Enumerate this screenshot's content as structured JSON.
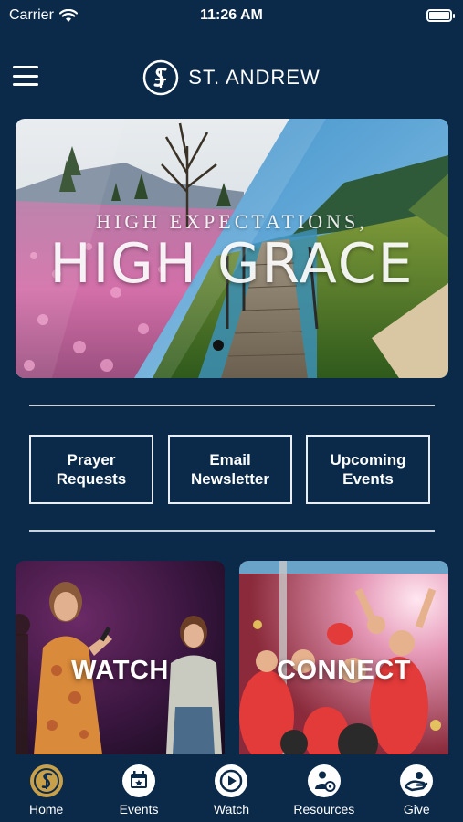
{
  "status": {
    "carrier": "Carrier",
    "time": "11:26 AM"
  },
  "header": {
    "brand_name": "ST. ANDREW"
  },
  "hero": {
    "subtitle": "HIGH EXPECTATIONS,",
    "title": "HIGH GRACE"
  },
  "quick_links": [
    {
      "label": "Prayer\nRequests"
    },
    {
      "label": "Email\nNewsletter"
    },
    {
      "label": "Upcoming\nEvents"
    }
  ],
  "tiles": [
    {
      "label": "WATCH"
    },
    {
      "label": "CONNECT"
    }
  ],
  "tabs": [
    {
      "label": "Home",
      "icon": "home-logo-icon"
    },
    {
      "label": "Events",
      "icon": "calendar-icon"
    },
    {
      "label": "Watch",
      "icon": "play-icon"
    },
    {
      "label": "Resources",
      "icon": "resources-icon"
    },
    {
      "label": "Give",
      "icon": "give-hand-icon"
    }
  ],
  "colors": {
    "background": "#0b2a4a",
    "accent_gold": "#c9a04a",
    "text": "#ffffff"
  }
}
